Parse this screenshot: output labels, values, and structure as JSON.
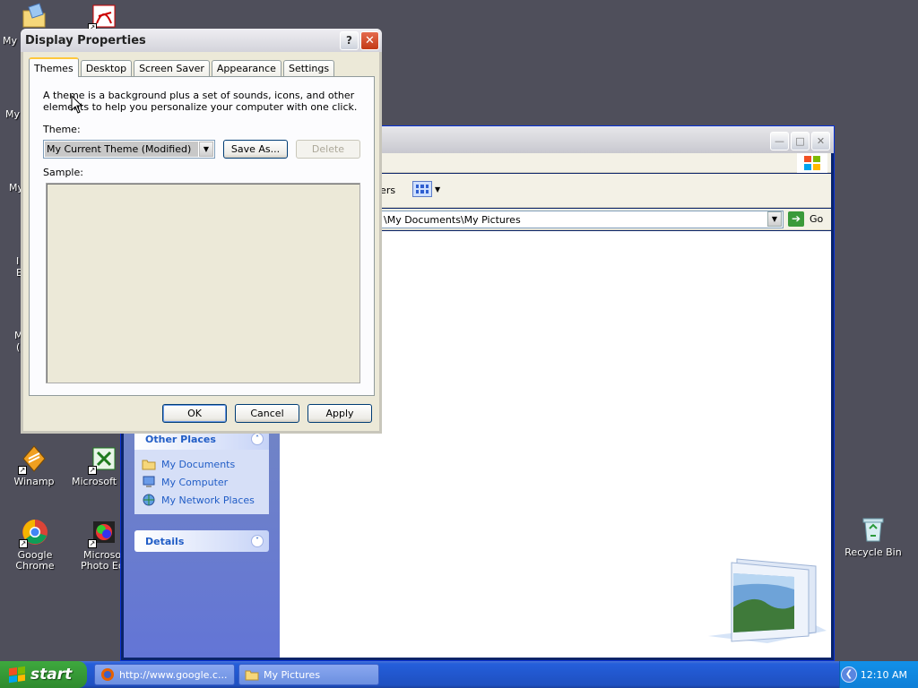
{
  "desktop": {
    "icons": {
      "winamp": "Winamp",
      "excel": "Microsoft E",
      "chrome": "Google Chrome",
      "photo_line1": "Microsof",
      "photo_line2": "Photo Edi",
      "recycle": "Recycle Bin"
    },
    "partial_labels": [
      "My",
      "My",
      "My",
      "I",
      "E",
      "M",
      "("
    ]
  },
  "explorer": {
    "toolbar_folders_text": "lers",
    "address": "\\My Documents\\My Pictures",
    "go_label": "Go",
    "other_places": {
      "title": "Other Places",
      "items": [
        "My Documents",
        "My Computer",
        "My Network Places"
      ]
    },
    "details": {
      "title": "Details"
    }
  },
  "dialog": {
    "title": "Display Properties",
    "tabs": [
      "Themes",
      "Desktop",
      "Screen Saver",
      "Appearance",
      "Settings"
    ],
    "description": "A theme is a background plus a set of sounds, icons, and other elements to help you personalize your computer with one click.",
    "theme_label": "Theme:",
    "theme_value": "My Current Theme (Modified)",
    "save_as_label": "Save As...",
    "delete_label": "Delete",
    "sample_label": "Sample:",
    "ok_label": "OK",
    "cancel_label": "Cancel",
    "apply_label": "Apply"
  },
  "taskbar": {
    "start_label": "start",
    "tasks": [
      "http://www.google.c...",
      "My Pictures"
    ],
    "clock": "12:10 AM"
  },
  "colors": {
    "desktop_bg": "#4f4f5b",
    "taskbar_blue": "#245edb",
    "start_green": "#3ea93e",
    "link_blue": "#215dc6"
  }
}
